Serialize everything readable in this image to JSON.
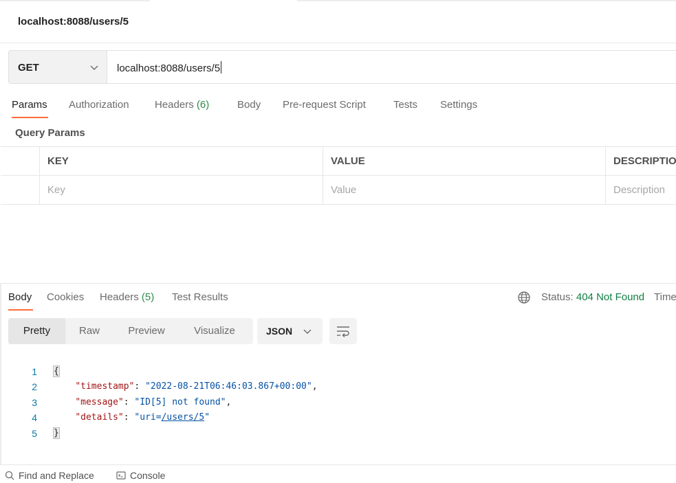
{
  "request": {
    "title": "localhost:8088/users/5",
    "method": "GET",
    "url": "localhost:8088/users/5"
  },
  "request_tabs": [
    {
      "label": "Params",
      "active": true
    },
    {
      "label": "Authorization"
    },
    {
      "label": "Headers",
      "count": "(6)"
    },
    {
      "label": "Body"
    },
    {
      "label": "Pre-request Script"
    },
    {
      "label": "Tests"
    },
    {
      "label": "Settings"
    }
  ],
  "query_params": {
    "title": "Query Params",
    "headers": [
      "KEY",
      "VALUE",
      "DESCRIPTION"
    ],
    "placeholders": [
      "Key",
      "Value",
      "Description"
    ]
  },
  "response_tabs": [
    {
      "label": "Body",
      "active": true
    },
    {
      "label": "Cookies"
    },
    {
      "label": "Headers",
      "count": "(5)"
    },
    {
      "label": "Test Results"
    }
  ],
  "response_status": {
    "label": "Status:",
    "value": "404 Not Found",
    "time_label": "Time"
  },
  "view_modes": [
    "Pretty",
    "Raw",
    "Preview",
    "Visualize"
  ],
  "format": "JSON",
  "body_lines": {
    "n1": "1",
    "n2": "2",
    "n3": "3",
    "n4": "4",
    "n5": "5",
    "open": "{",
    "close": "}",
    "k1": "\"timestamp\"",
    "v1": "\"2022-08-21T06:46:03.867+00:00\"",
    "k2": "\"message\"",
    "v2": "\"ID[5] not found\"",
    "k3": "\"details\"",
    "v3_prefix": "\"uri=",
    "v3_link": "/users/5",
    "v3_suffix": "\""
  },
  "footer": {
    "find_replace": "Find and Replace",
    "console": "Console"
  },
  "colors": {
    "accent": "#ff6c37",
    "status_error": "#0f7f43",
    "json_key": "#a31515",
    "json_string": "#0451a5"
  }
}
